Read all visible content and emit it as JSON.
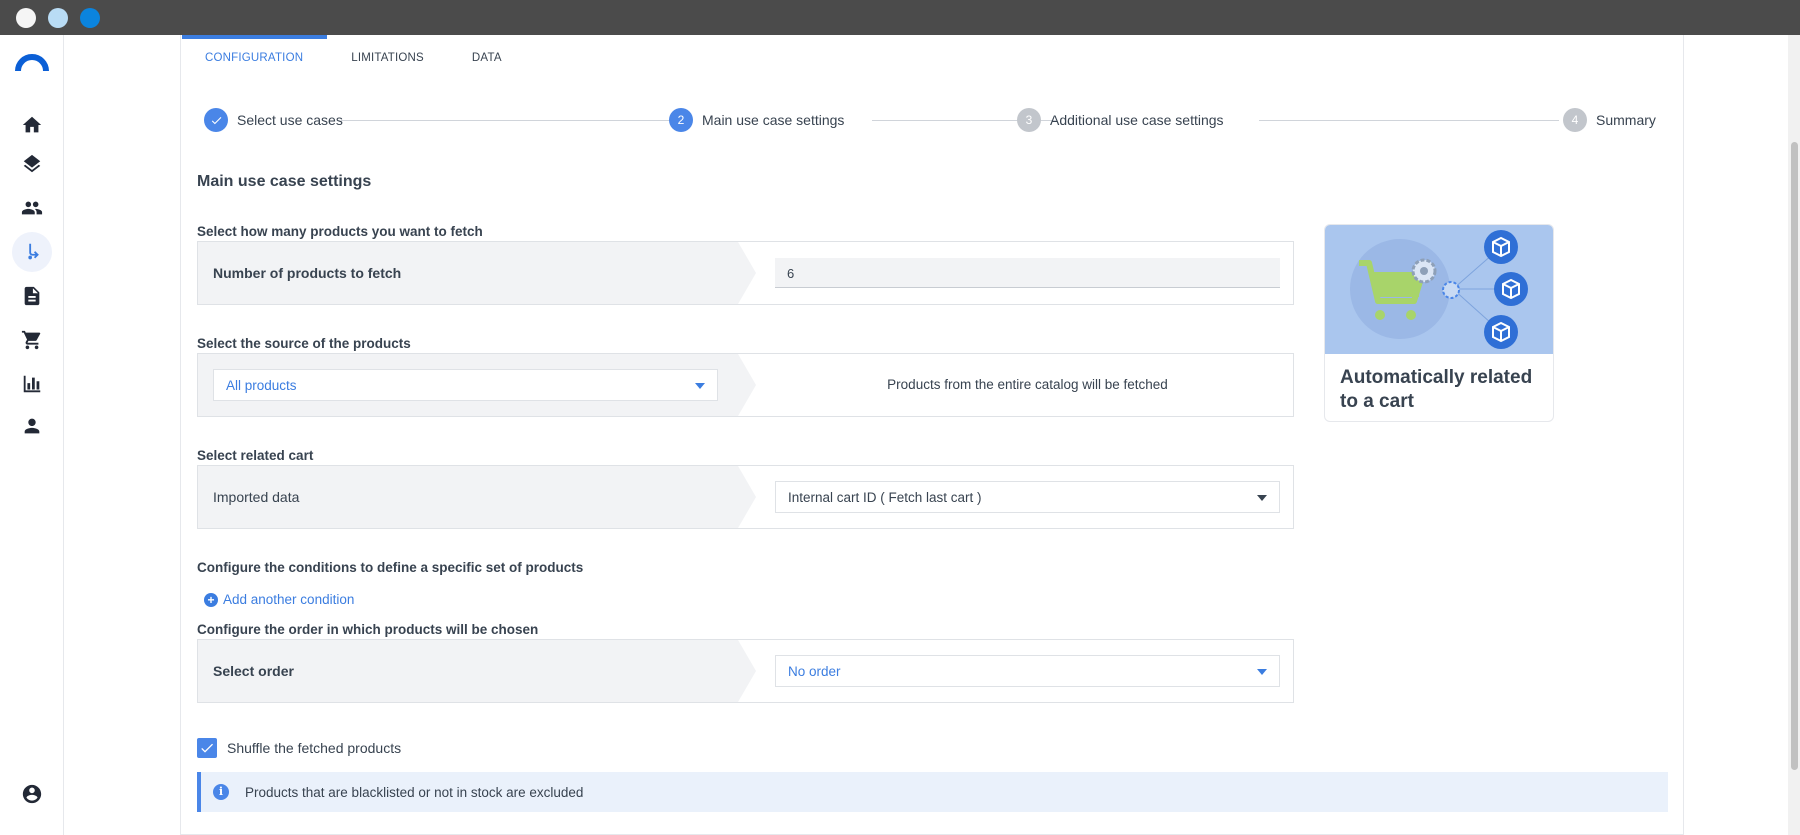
{
  "tabs": [
    {
      "label": "CONFIGURATION",
      "active": true
    },
    {
      "label": "LIMITATIONS",
      "active": false
    },
    {
      "label": "DATA",
      "active": false
    }
  ],
  "stepper": {
    "steps": [
      {
        "number": "✓",
        "label": "Select use cases",
        "state": "done"
      },
      {
        "number": "2",
        "label": "Main use case settings",
        "state": "current"
      },
      {
        "number": "3",
        "label": "Additional use case settings",
        "state": "todo"
      },
      {
        "number": "4",
        "label": "Summary",
        "state": "todo"
      }
    ]
  },
  "main": {
    "title": "Main use case settings",
    "fetch": {
      "heading": "Select how many products you want to fetch",
      "label": "Number of products to fetch",
      "value": "6"
    },
    "source": {
      "heading": "Select the source of the products",
      "selected": "All products",
      "description": "Products from the entire catalog will be fetched"
    },
    "cart": {
      "heading": "Select related cart",
      "label": "Imported data",
      "selected": "Internal cart ID ( Fetch last cart )"
    },
    "conditions": {
      "heading": "Configure the conditions to define a specific set of products",
      "add_label": "Add another condition"
    },
    "order": {
      "heading": "Configure the order in which products will be chosen",
      "label": "Select order",
      "selected": "No order"
    },
    "shuffle": {
      "label": "Shuffle the fetched products",
      "checked": true
    },
    "info": "Products that are blacklisted or not in stock are excluded"
  },
  "illustration": {
    "title": "Automatically related to a cart"
  },
  "colors": {
    "accent": "#4a86e8",
    "link": "#3b7de0",
    "titlebar": "#4b4b4b"
  },
  "sidebar": {
    "items": [
      {
        "icon": "home-icon"
      },
      {
        "icon": "layers-icon"
      },
      {
        "icon": "people-icon"
      },
      {
        "icon": "flow-icon",
        "active": true
      },
      {
        "icon": "document-icon"
      },
      {
        "icon": "cart-icon"
      },
      {
        "icon": "bar-chart-icon"
      },
      {
        "icon": "person-icon"
      },
      {
        "icon": "account-circle-icon"
      }
    ]
  }
}
